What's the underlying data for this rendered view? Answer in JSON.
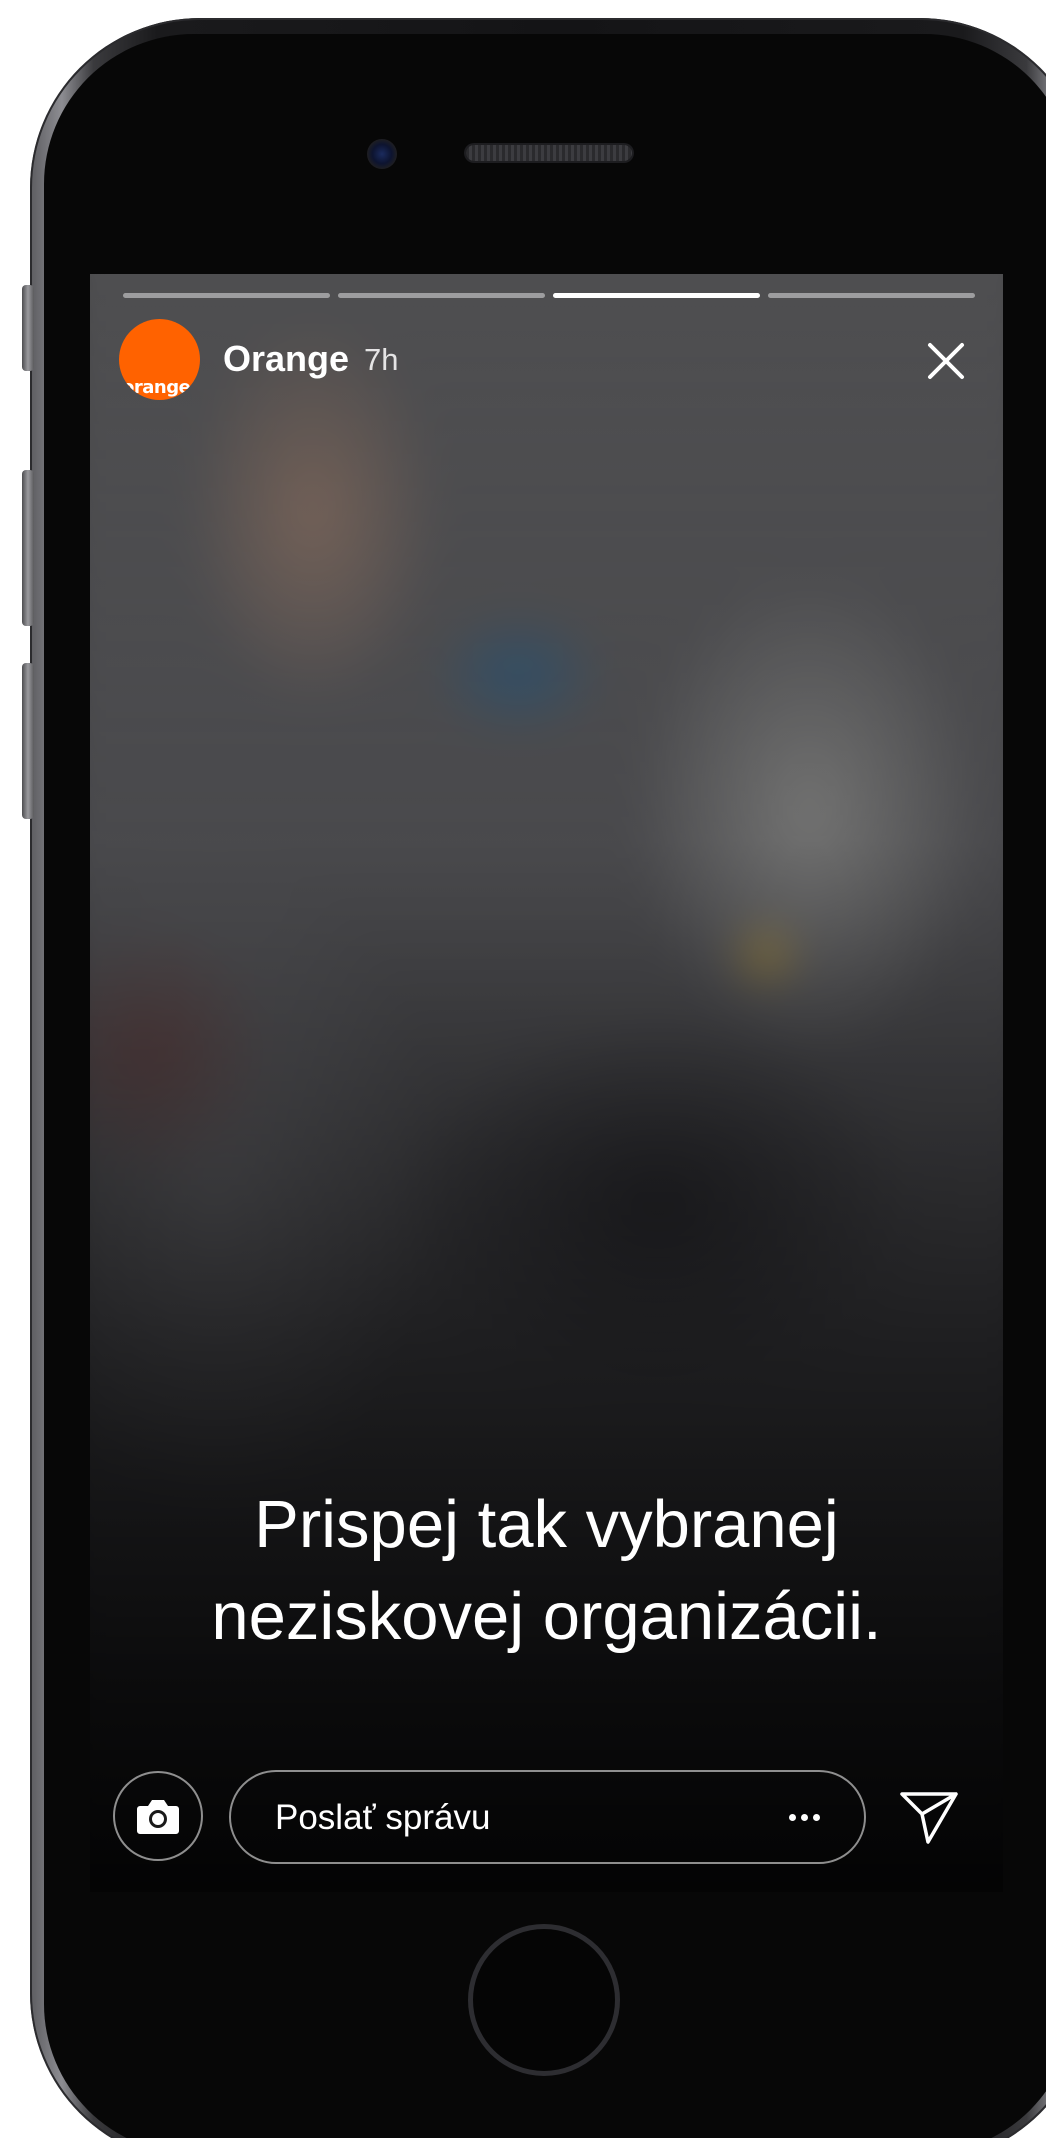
{
  "story": {
    "account_name": "Orange",
    "avatar_text": "orange",
    "posted_ago": "7h",
    "segments": [
      {
        "progress": 0
      },
      {
        "progress": 0
      },
      {
        "progress": 1
      },
      {
        "progress": 0
      }
    ],
    "caption": "Prispej tak vybranej\nneziskovej organizácii."
  },
  "reply_bar": {
    "message_placeholder": "Poslať správu"
  },
  "icons": {
    "close": "close-icon",
    "camera": "camera-icon",
    "more": "more-options-icon",
    "send": "send-icon"
  },
  "colors": {
    "brand": "#ff6200",
    "text": "#ffffff"
  }
}
